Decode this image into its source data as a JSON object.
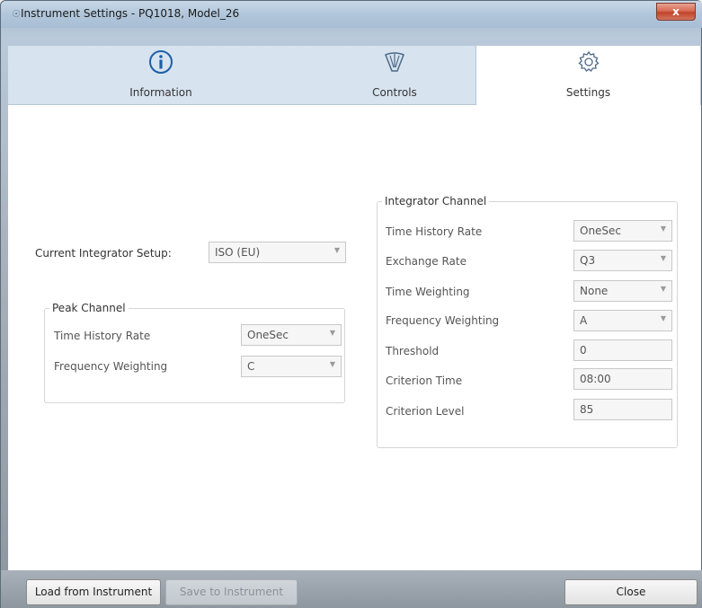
{
  "window": {
    "title": "Instrument Settings - PQ1018, Model_26",
    "close_label": "x"
  },
  "tabs": [
    {
      "label": "Information",
      "icon": "info-icon"
    },
    {
      "label": "Controls",
      "icon": "controls-icon"
    },
    {
      "label": "Settings",
      "icon": "gear-icon",
      "selected": true
    }
  ],
  "setup": {
    "label": "Current Integrator Setup:",
    "value": "ISO (EU)"
  },
  "peak_channel": {
    "title": "Peak Channel",
    "rows": [
      {
        "label": "Time History Rate",
        "value": "OneSec",
        "kind": "combo"
      },
      {
        "label": "Frequency Weighting",
        "value": "C",
        "kind": "combo"
      }
    ]
  },
  "integrator_channel": {
    "title": "Integrator Channel",
    "rows": [
      {
        "label": "Time History Rate",
        "value": "OneSec",
        "kind": "combo"
      },
      {
        "label": "Exchange Rate",
        "value": "Q3",
        "kind": "combo"
      },
      {
        "label": "Time Weighting",
        "value": "None",
        "kind": "combo"
      },
      {
        "label": "Frequency Weighting",
        "value": "A",
        "kind": "combo"
      },
      {
        "label": "Threshold",
        "value": "0",
        "kind": "text"
      },
      {
        "label": "Criterion Time",
        "value": "08:00",
        "kind": "text"
      },
      {
        "label": "Criterion Level",
        "value": "85",
        "kind": "text"
      }
    ]
  },
  "buttons": {
    "load": "Load from Instrument",
    "save": "Save to Instrument",
    "close": "Close"
  },
  "colors": {
    "tab_bar": "#d7e3ef",
    "close_button": "#c2432a"
  }
}
